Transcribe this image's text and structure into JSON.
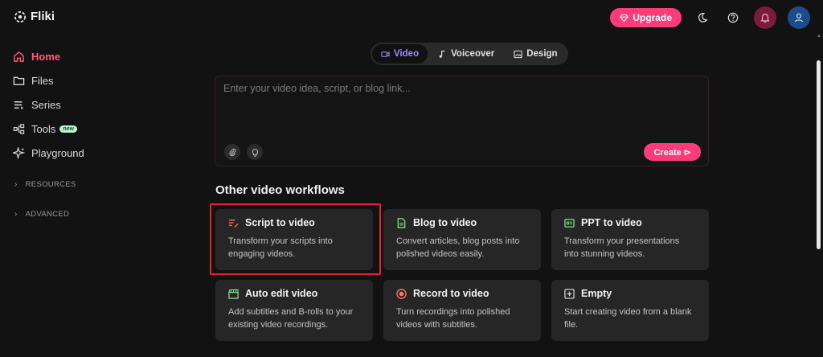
{
  "brand": {
    "name": "Fliki"
  },
  "sidebar": {
    "items": [
      {
        "label": "Home",
        "icon": "home-icon"
      },
      {
        "label": "Files",
        "icon": "folder-icon"
      },
      {
        "label": "Series",
        "icon": "list-icon"
      },
      {
        "label": "Tools",
        "icon": "tools-icon",
        "badge": "new"
      },
      {
        "label": "Playground",
        "icon": "sparkle-icon"
      }
    ],
    "sections": [
      {
        "label": "RESOURCES"
      },
      {
        "label": "ADVANCED"
      }
    ]
  },
  "header": {
    "upgrade_label": "Upgrade"
  },
  "tabs": [
    {
      "label": "Video",
      "active": true
    },
    {
      "label": "Voiceover",
      "active": false
    },
    {
      "label": "Design",
      "active": false
    }
  ],
  "prompt": {
    "placeholder": "Enter your video idea, script, or blog link...",
    "create_label": "Create ⊳"
  },
  "workflows": {
    "title": "Other video workflows",
    "cards": [
      {
        "title": "Script to video",
        "desc": "Transform your scripts into engaging videos.",
        "icon": "script-icon",
        "icon_color": "#ff6b5a"
      },
      {
        "title": "Blog to video",
        "desc": "Convert articles, blog posts into polished videos easily.",
        "icon": "document-icon",
        "icon_color": "#7ee08a"
      },
      {
        "title": "PPT to video",
        "desc": "Transform your presentations into stunning videos.",
        "icon": "presentation-icon",
        "icon_color": "#7ee08a"
      },
      {
        "title": "Auto edit video",
        "desc": "Add subtitles and B-rolls to your existing video recordings.",
        "icon": "clapper-icon",
        "icon_color": "#7ee08a"
      },
      {
        "title": "Record to video",
        "desc": "Turn recordings into polished videos with subtitles.",
        "icon": "record-icon",
        "icon_color": "#ff7a5a"
      },
      {
        "title": "Empty",
        "desc": "Start creating video from a blank file.",
        "icon": "plus-square-icon",
        "icon_color": "#e0e0e0"
      }
    ]
  },
  "colors": {
    "accent": "#ff3b7a",
    "active_nav": "#ff5a7a",
    "active_tab": "#9d8cff",
    "highlight": "#e0262e"
  }
}
